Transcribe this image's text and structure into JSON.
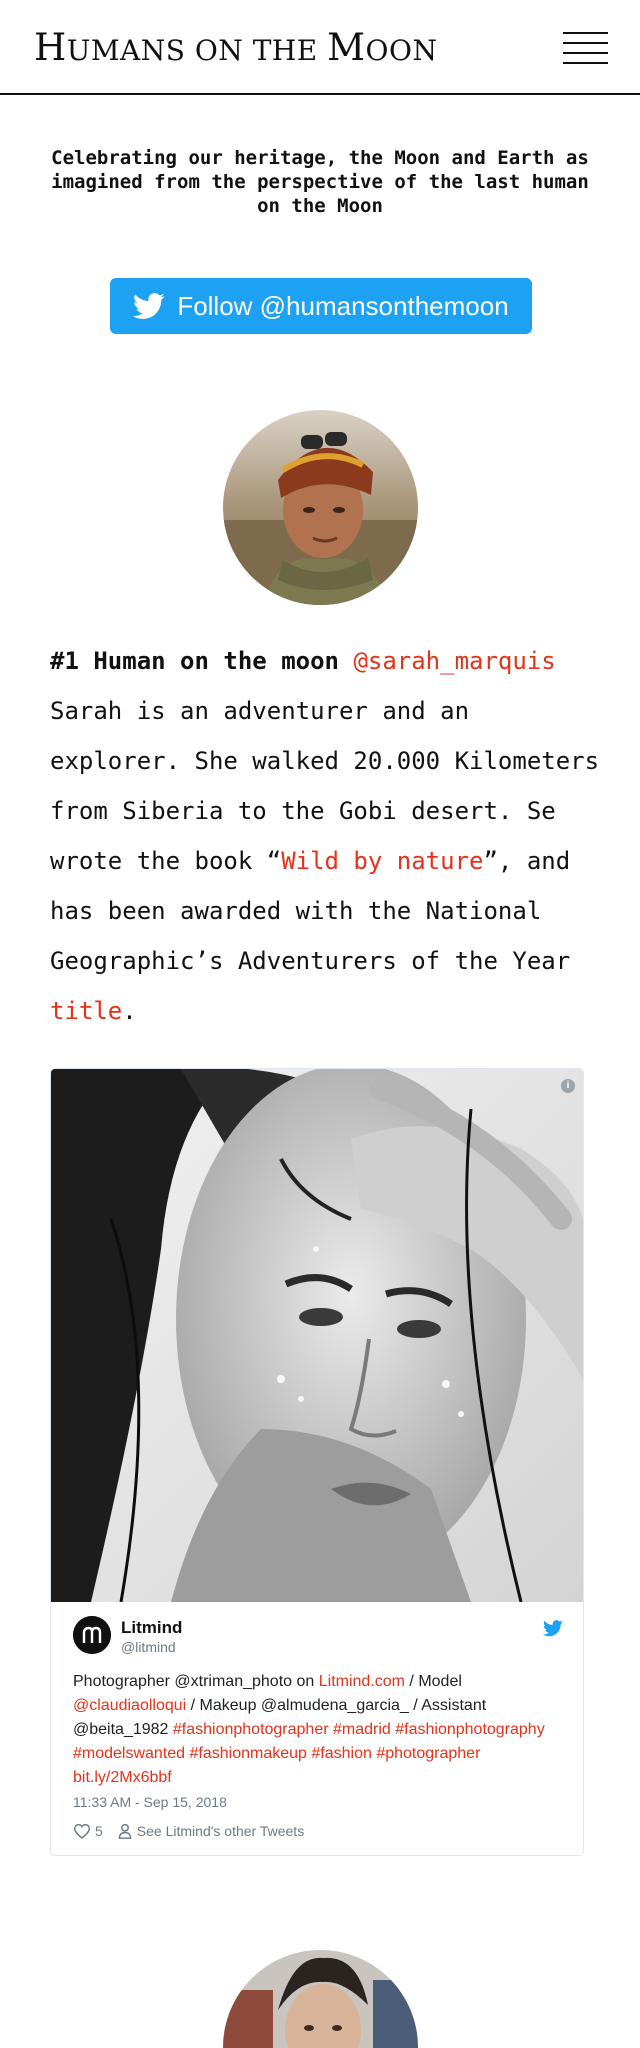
{
  "header": {
    "title_initial_1": "H",
    "title_rest_1": "UMANS ON THE ",
    "title_initial_2": "M",
    "title_rest_2": "OON"
  },
  "tagline": "Celebrating our heritage, the Moon and Earth as imagined from the perspective of the last human on the Moon",
  "follow_button": {
    "label": "Follow @humansonthemoon",
    "color": "#1da1f2"
  },
  "profile": {
    "heading": "#1 Human on the moon",
    "handle": "@sarah_marquis",
    "bio_part1": "Sarah is an adventurer and an explorer. She walked 20.000 Kilometers from Siberia to the Gobi desert. Se wrote the book “",
    "book_link": "Wild by nature",
    "bio_part2": "”, and has been awarded with the National Geographic’s Adventurers of the Year ",
    "title_link": "title",
    "bio_end": ".",
    "accent_color": "#e5321b"
  },
  "tweet": {
    "author_name": "Litmind",
    "author_handle": "@litmind",
    "text_1": "Photographer @xtriman_photo on ",
    "link_site": "Litmind.com",
    "text_2": " / Model ",
    "link_model": "@claudiaolloqui",
    "text_3": " / Makeup @almudena_garcia_ / Assistant @beita_1982 ",
    "hashtags": "#fashionphotographer #madrid #fashionphotography #modelswanted #fashionmakeup #fashion #photographer",
    "short_link": "bit.ly/2Mx6bbf",
    "timestamp": "11:33 AM - Sep 15, 2018",
    "likes": "5",
    "see_more": "See Litmind's other Tweets",
    "icons": [
      "info-icon",
      "twitter-bird-icon",
      "heart-icon",
      "person-icon"
    ]
  }
}
